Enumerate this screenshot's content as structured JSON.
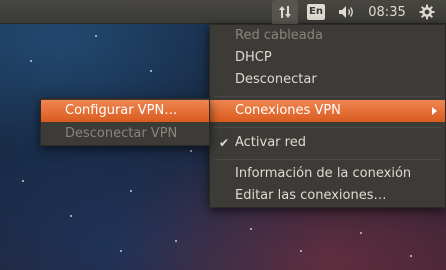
{
  "panel": {
    "language_indicator": "En",
    "clock": "08:35",
    "icons": [
      "network-updown-icon",
      "keyboard-language-icon",
      "volume-icon",
      "gear-icon"
    ]
  },
  "network_menu": {
    "items": [
      {
        "label": "Red cableada",
        "enabled": false
      },
      {
        "label": "DHCP",
        "enabled": true
      },
      {
        "label": "Desconectar",
        "enabled": true
      },
      {
        "label": "Conexiones VPN",
        "enabled": true,
        "highlighted": true,
        "has_submenu": true
      },
      {
        "label": "Activar red",
        "enabled": true,
        "checked": true
      },
      {
        "label": "Información de la conexión",
        "enabled": true
      },
      {
        "label": "Editar las conexiones…",
        "enabled": true
      }
    ]
  },
  "vpn_submenu": {
    "items": [
      {
        "label": "Configurar VPN…",
        "enabled": true,
        "highlighted": true
      },
      {
        "label": "Desconectar VPN",
        "enabled": false
      }
    ]
  },
  "colors": {
    "panel_bg": "#3c3b37",
    "highlight": "#e8733a",
    "text": "#dfdbd2",
    "disabled_text": "#88857d"
  }
}
